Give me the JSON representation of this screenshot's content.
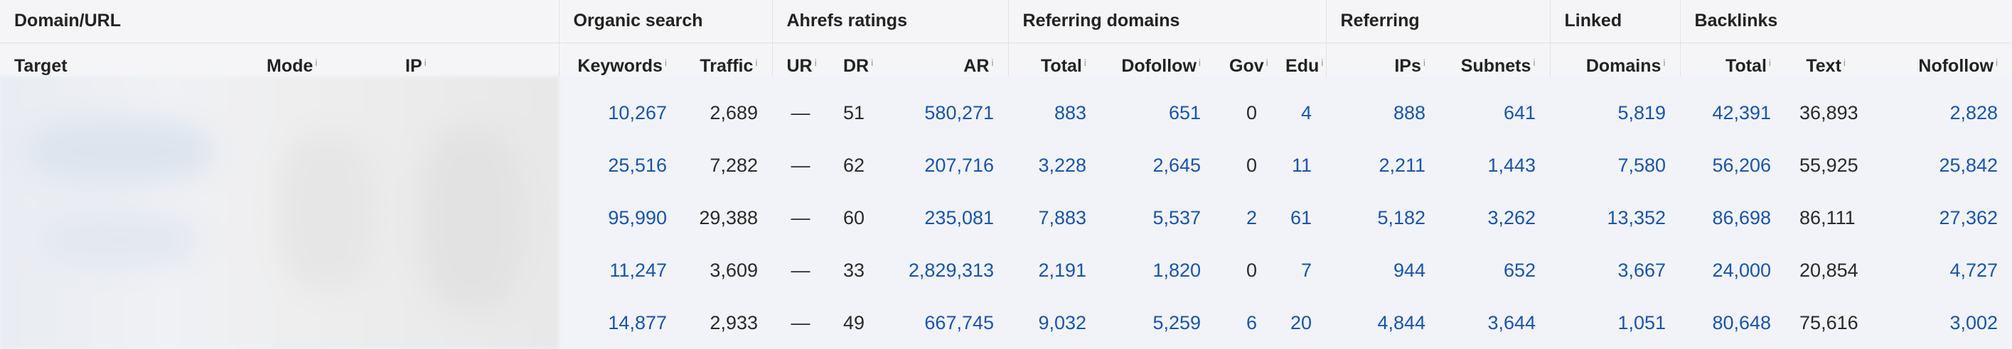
{
  "groups": {
    "domain_url": "Domain/URL",
    "organic_search": "Organic search",
    "ahrefs_ratings": "Ahrefs ratings",
    "referring_domains": "Referring domains",
    "referring": "Referring",
    "linked": "Linked",
    "backlinks": "Backlinks"
  },
  "columns": {
    "target": "Target",
    "mode": "Mode",
    "ip": "IP",
    "keywords": "Keywords",
    "traffic": "Traffic",
    "ur": "UR",
    "dr": "DR",
    "ar": "AR",
    "rd_total": "Total",
    "dofollow": "Dofollow",
    "gov": "Gov",
    "edu": "Edu",
    "ips": "IPs",
    "subnets": "Subnets",
    "domains": "Domains",
    "bl_total": "Total",
    "text": "Text",
    "nofollow": "Nofollow"
  },
  "info_marker": "i",
  "colors": {
    "link": "#1a54a8",
    "header_bg": "#f5f5f7",
    "row_bg": "#f1f3f8"
  },
  "rows": [
    {
      "keywords": "10,267",
      "traffic": "2,689",
      "ur": "—",
      "dr": "51",
      "ar": "580,271",
      "rd_total": "883",
      "dofollow": "651",
      "gov": "0",
      "edu": "4",
      "ips": "888",
      "subnets": "641",
      "domains": "5,819",
      "bl_total": "42,391",
      "text": "36,893",
      "nofollow": "2,828"
    },
    {
      "keywords": "25,516",
      "traffic": "7,282",
      "ur": "—",
      "dr": "62",
      "ar": "207,716",
      "rd_total": "3,228",
      "dofollow": "2,645",
      "gov": "0",
      "edu": "11",
      "ips": "2,211",
      "subnets": "1,443",
      "domains": "7,580",
      "bl_total": "56,206",
      "text": "55,925",
      "nofollow": "25,842"
    },
    {
      "keywords": "95,990",
      "traffic": "29,388",
      "ur": "—",
      "dr": "60",
      "ar": "235,081",
      "rd_total": "7,883",
      "dofollow": "5,537",
      "gov": "2",
      "edu": "61",
      "ips": "5,182",
      "subnets": "3,262",
      "domains": "13,352",
      "bl_total": "86,698",
      "text": "86,111",
      "nofollow": "27,362"
    },
    {
      "keywords": "11,247",
      "traffic": "3,609",
      "ur": "—",
      "dr": "33",
      "ar": "2,829,313",
      "rd_total": "2,191",
      "dofollow": "1,820",
      "gov": "0",
      "edu": "7",
      "ips": "944",
      "subnets": "652",
      "domains": "3,667",
      "bl_total": "24,000",
      "text": "20,854",
      "nofollow": "4,727"
    },
    {
      "keywords": "14,877",
      "traffic": "2,933",
      "ur": "—",
      "dr": "49",
      "ar": "667,745",
      "rd_total": "9,032",
      "dofollow": "5,259",
      "gov": "6",
      "edu": "20",
      "ips": "4,844",
      "subnets": "3,644",
      "domains": "1,051",
      "bl_total": "80,648",
      "text": "75,616",
      "nofollow": "3,002"
    }
  ]
}
